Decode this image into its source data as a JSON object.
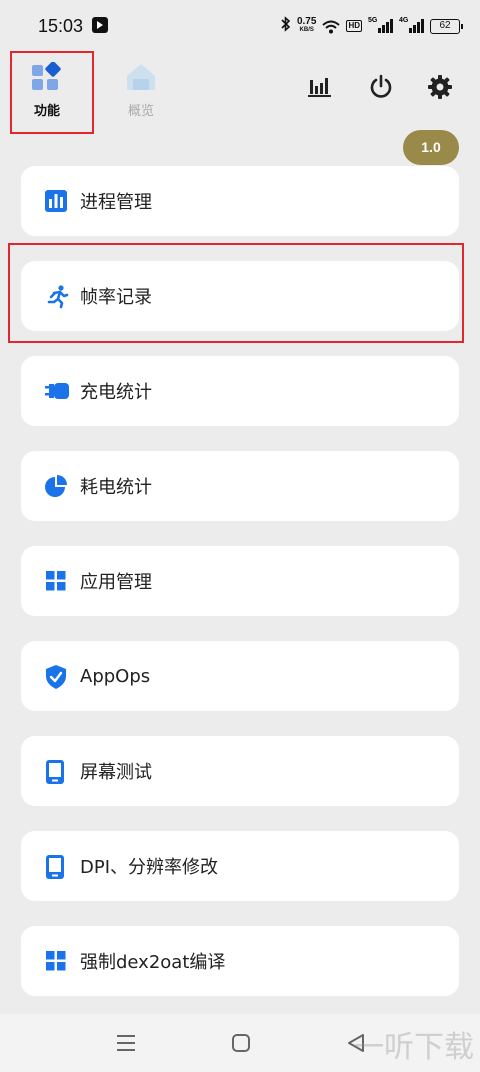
{
  "status_bar": {
    "time": "15:03",
    "net_speed_value": "0.75",
    "net_speed_unit": "KB/S",
    "hd_label": "HD",
    "signal_1_tag": "5G",
    "signal_2_tag": "4G",
    "battery": "62"
  },
  "top_bar": {
    "tab_functions_label": "功能",
    "tab_overview_label": "概览",
    "version": "1.0"
  },
  "menu": [
    {
      "label": "进程管理",
      "icon": "bar-chart-icon"
    },
    {
      "label": "帧率记录",
      "icon": "running-person-icon"
    },
    {
      "label": "充电统计",
      "icon": "charger-plug-icon"
    },
    {
      "label": "耗电统计",
      "icon": "pie-chart-icon"
    },
    {
      "label": "应用管理",
      "icon": "grid-icon"
    },
    {
      "label": "AppOps",
      "icon": "shield-check-icon"
    },
    {
      "label": "屏幕测试",
      "icon": "tablet-icon"
    },
    {
      "label": "DPI、分辨率修改",
      "icon": "tablet-icon"
    },
    {
      "label": "强制dex2oat编译",
      "icon": "grid-icon"
    }
  ],
  "watermark": "一听下载",
  "colors": {
    "accent": "#1a73e8",
    "background": "#ececec",
    "version_badge": "#9a8a4a",
    "highlight": "#e0282e"
  }
}
